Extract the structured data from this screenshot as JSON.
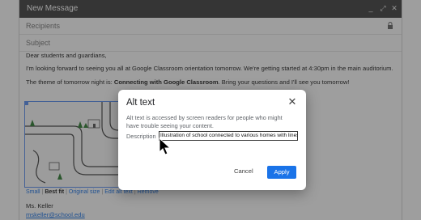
{
  "window": {
    "title": "New Message",
    "recipients_placeholder": "Recipients",
    "subject_placeholder": "Subject",
    "controls": {
      "minimize": "_",
      "expand": "⤢",
      "close": "✕"
    }
  },
  "email": {
    "greeting": "Dear students and guardians,",
    "p1": "I'm looking forward to seeing you all at Google Classroom orientation tomorrow. We're getting started at 4:30pm in the main auditorium.",
    "p2_prefix": "The theme of tomorrow night is: ",
    "p2_bold": "Connecting with Google Classroom",
    "p2_suffix": ". Bring your questions and I'll see you tomorrow!",
    "signature_name": "Ms. Keller",
    "signature_email": "mskeller@school.edu"
  },
  "image_toolbar": {
    "small": "Small",
    "best_fit": "Best fit",
    "original_size": "Original size",
    "edit_alt_text": "Edit alt text",
    "remove": "Remove",
    "separator": "|"
  },
  "dialog": {
    "title": "Alt text",
    "description": "Alt text is accessed by screen readers for people who might have trouble seeing your content.",
    "label": "Description",
    "input_value": "Illustration of school connected to various homes with lines.",
    "cancel": "Cancel",
    "apply": "Apply",
    "close_icon": "close-icon"
  },
  "colors": {
    "accent": "#1a73e8",
    "titlebar": "#404040"
  }
}
